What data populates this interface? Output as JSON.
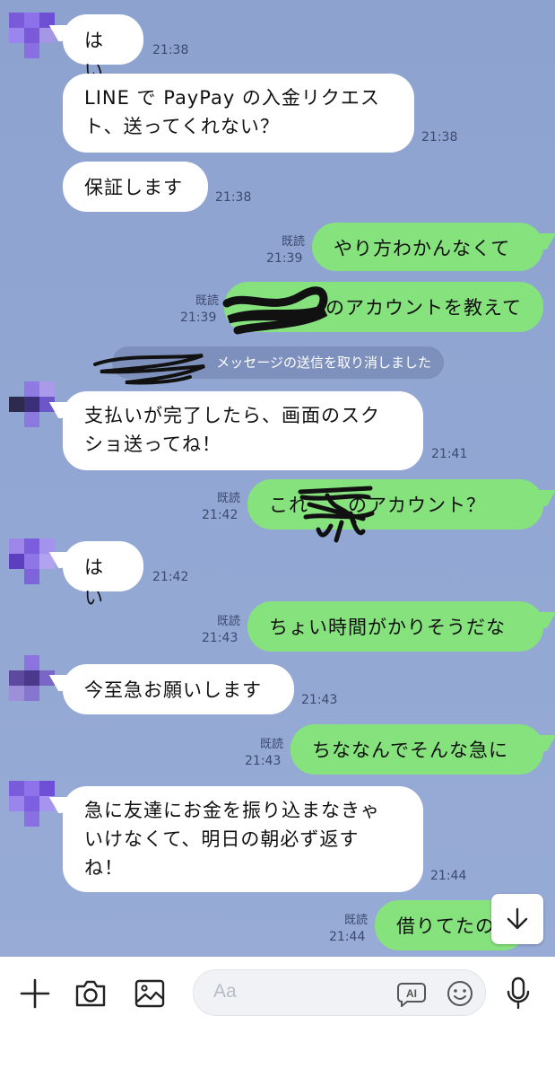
{
  "messages": [
    {
      "dir": "in",
      "text": "はい",
      "time": "21:38"
    },
    {
      "dir": "in",
      "text": "LINE で PayPay の入金リクエスト、送ってくれない？",
      "text_lines": [
        "LINE で PayPay の入金リクエス",
        "ト、送ってくれない？"
      ],
      "time": "21:38"
    },
    {
      "dir": "in",
      "text": "保証します",
      "time": "21:38"
    },
    {
      "dir": "out",
      "text": "やり方わかんなくて",
      "read": "既読",
      "time": "21:39"
    },
    {
      "dir": "out",
      "text": "のアカウントを教えて",
      "read": "既読",
      "time": "21:39"
    },
    {
      "dir": "system",
      "text": "がメッセージの送信を取り消しました",
      "visible_text": "メッセージの送信を取り消しました"
    },
    {
      "dir": "in",
      "text": "支払いが完了したら、画面のスクショ送ってね！",
      "text_lines": [
        "支払いが完了したら、画面のスク",
        "ショ送ってね！"
      ],
      "time": "21:41"
    },
    {
      "dir": "out",
      "text": "これ　　のアカウント？",
      "read": "既読",
      "time": "21:42"
    },
    {
      "dir": "in",
      "text": "はい",
      "time": "21:42"
    },
    {
      "dir": "out",
      "text": "ちょい時間がかりそうだな",
      "read": "既読",
      "time": "21:43"
    },
    {
      "dir": "in",
      "text": "今至急お願いします",
      "time": "21:43"
    },
    {
      "dir": "out",
      "text": "ちななんでそんな急に",
      "read": "既読",
      "time": "21:43"
    },
    {
      "dir": "in",
      "text": "急に友達にお金を振り込まなきゃいけなくて、明日の朝必ず返すね！",
      "text_lines": [
        "急に友達にお金を振り込まなきゃ",
        "いけなくて、明日の朝必ず返す",
        "ね！"
      ],
      "time": "21:44"
    },
    {
      "dir": "out",
      "text": "借りてたの",
      "read": "既読",
      "time": "21:44"
    }
  ],
  "composer": {
    "placeholder": "Aa",
    "icons": [
      "plus-icon",
      "camera-icon",
      "image-icon",
      "ai-icon",
      "emoji-icon",
      "microphone-icon"
    ],
    "ai_label": "AI"
  },
  "scroll_button_icon": "arrow-down-icon",
  "colors": {
    "chat_background": "#8fa3d2",
    "incoming_bubble": "#ffffff",
    "outgoing_bubble": "#86e27d",
    "avatar": "#7c5ce6"
  }
}
